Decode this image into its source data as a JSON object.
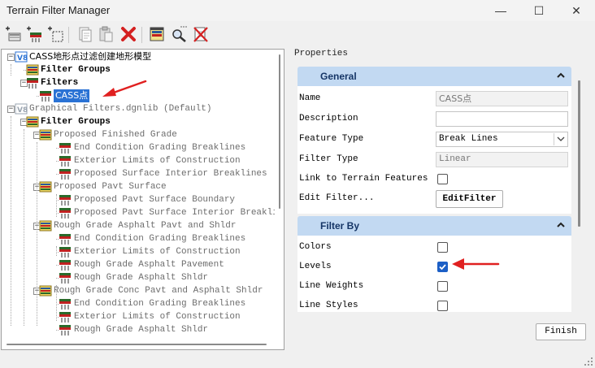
{
  "window": {
    "title": "Terrain Filter Manager",
    "minimize": "—",
    "maximize": "☐",
    "close": "✕"
  },
  "toolbar": {
    "buttons": [
      {
        "name": "new-filter-group-icon"
      },
      {
        "name": "new-filter-icon"
      },
      {
        "name": "new-graphical-filter-icon"
      },
      {
        "name": "copy-icon"
      },
      {
        "name": "paste-icon"
      },
      {
        "name": "delete-icon"
      },
      {
        "name": "edit-filter-icon"
      },
      {
        "name": "test-filter-icon"
      },
      {
        "name": "clear-test-icon"
      }
    ]
  },
  "tree": {
    "rows": [
      {
        "label": "CASS地形点过滤创建地形模型",
        "level": 0,
        "type": "model"
      },
      {
        "label": "Filter Groups",
        "level": 1,
        "type": "group"
      },
      {
        "label": "Filters",
        "level": 1,
        "type": "filter"
      },
      {
        "label": "CASS点",
        "level": 2,
        "type": "filter",
        "selected": true
      },
      {
        "label": "Graphical Filters.dgnlib (Default)",
        "level": 0,
        "type": "model-gray"
      },
      {
        "label": "Filter Groups",
        "level": 1,
        "type": "group"
      },
      {
        "label": "Proposed Finished Grade",
        "level": 2,
        "type": "group-gray"
      },
      {
        "label": "End Condition Grading Breaklines",
        "level": 3,
        "type": "filter-gray"
      },
      {
        "label": "Exterior Limits of Construction",
        "level": 3,
        "type": "filter-gray"
      },
      {
        "label": "Proposed Surface Interior Breaklines",
        "level": 3,
        "type": "filter-gray"
      },
      {
        "label": "Proposed Pavt Surface",
        "level": 2,
        "type": "group-gray"
      },
      {
        "label": "Proposed Pavt Surface Boundary",
        "level": 3,
        "type": "filter-gray"
      },
      {
        "label": "Proposed Pavt Surface Interior Breaklin",
        "level": 3,
        "type": "filter-gray"
      },
      {
        "label": "Rough Grade Asphalt Pavt and Shldr",
        "level": 2,
        "type": "group-gray"
      },
      {
        "label": "End Condition Grading Breaklines",
        "level": 3,
        "type": "filter-gray"
      },
      {
        "label": "Exterior Limits of Construction",
        "level": 3,
        "type": "filter-gray"
      },
      {
        "label": "Rough Grade Asphalt Pavement",
        "level": 3,
        "type": "filter-gray"
      },
      {
        "label": "Rough Grade Asphalt Shldr",
        "level": 3,
        "type": "filter-gray"
      },
      {
        "label": "Rough Grade Conc Pavt and Asphalt Shldr",
        "level": 2,
        "type": "group-gray"
      },
      {
        "label": "End Condition Grading Breaklines",
        "level": 3,
        "type": "filter-gray"
      },
      {
        "label": "Exterior Limits of Construction",
        "level": 3,
        "type": "filter-gray"
      },
      {
        "label": "Rough Grade Asphalt Shldr",
        "level": 3,
        "type": "filter-gray"
      }
    ]
  },
  "properties": {
    "title": "Properties",
    "general": {
      "header": "General",
      "name_label": "Name",
      "name_value": "CASS点",
      "description_label": "Description",
      "description_value": "",
      "feature_type_label": "Feature Type",
      "feature_type_value": "Break Lines",
      "filter_type_label": "Filter Type",
      "filter_type_value": "Linear",
      "link_label": "Link to Terrain Features",
      "link_checked": false,
      "edit_filter_label": "Edit Filter...",
      "edit_filter_button": "EditFilter"
    },
    "filter_by": {
      "header": "Filter By",
      "items": [
        {
          "label": "Colors",
          "checked": false
        },
        {
          "label": "Levels",
          "checked": true
        },
        {
          "label": "Line Weights",
          "checked": false
        },
        {
          "label": "Line Styles",
          "checked": false
        }
      ]
    }
  },
  "footer": {
    "finish_button": "Finish"
  },
  "colors": {
    "accent": "#2a72d4",
    "section_header": "#c2d9f2",
    "annotation_arrow": "#e02020"
  }
}
